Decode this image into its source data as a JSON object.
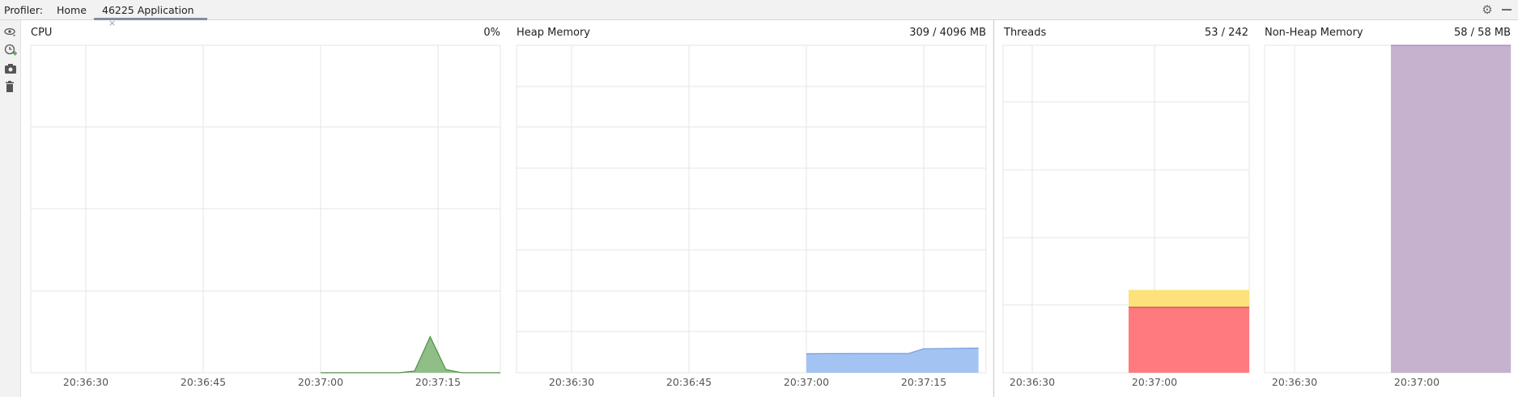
{
  "topbar": {
    "profiler_label": "Profiler:",
    "tabs": [
      {
        "label": "Home"
      },
      {
        "label": "46225 Application",
        "close": "×"
      }
    ],
    "icons": [
      "gear-icon",
      "minimize-icon"
    ]
  },
  "toolbar": {
    "icons": [
      "eye-icon",
      "add-timer-icon",
      "camera-icon",
      "trash-icon"
    ]
  },
  "panels": {
    "cpu": {
      "title": "CPU",
      "value": "0%"
    },
    "heap": {
      "title": "Heap Memory",
      "value": "309 / 4096 MB"
    },
    "threads": {
      "title": "Threads",
      "value": "53 / 242"
    },
    "nonheap": {
      "title": "Non-Heap Memory",
      "value": "58 / 58 MB"
    }
  },
  "colors": {
    "cpu": "#8fbf86",
    "cpu_line": "#4e8f45",
    "heap": "#a3c3f3",
    "heap_line": "#6f9de0",
    "threads_yellow": "#fde27c",
    "threads_red": "#ff7a7f",
    "nonheap": "#c6b1cf",
    "grid": "#e6e6e6"
  },
  "chart_data": [
    {
      "type": "area",
      "title": "CPU",
      "x_ticks": [
        "20:36:30",
        "20:36:45",
        "20:37:00",
        "20:37:15"
      ],
      "series": [
        {
          "values": [
            [
              "20:37:00",
              0
            ],
            [
              "20:37:10",
              0
            ],
            [
              "20:37:12",
              0.5
            ],
            [
              "20:37:14",
              11
            ],
            [
              "20:37:16",
              1
            ],
            [
              "20:37:18",
              0
            ],
            [
              "20:37:23",
              0
            ]
          ]
        }
      ],
      "ylim": [
        0,
        100
      ]
    },
    {
      "type": "area",
      "title": "Heap Memory",
      "x_ticks": [
        "20:36:30",
        "20:36:45",
        "20:37:00",
        "20:37:15"
      ],
      "series": [
        {
          "values": [
            [
              "20:37:00",
              238
            ],
            [
              "20:37:07",
              240
            ],
            [
              "20:37:13",
              240
            ],
            [
              "20:37:15",
              300
            ],
            [
              "20:37:22",
              309
            ]
          ]
        }
      ],
      "ylim": [
        0,
        4096
      ]
    },
    {
      "type": "bar",
      "title": "Threads",
      "x_ticks": [
        "20:36:30",
        "20:37:00"
      ],
      "series": [
        {
          "name": "red",
          "values": [
            [
              "20:37:00",
              200
            ]
          ]
        },
        {
          "name": "yellow",
          "values": [
            [
              "20:37:00",
              53
            ]
          ]
        }
      ],
      "ylim": [
        0,
        1000
      ]
    },
    {
      "type": "area",
      "title": "Non-Heap Memory",
      "x_ticks": [
        "20:36:30",
        "20:37:00"
      ],
      "series": [
        {
          "values": [
            [
              "20:37:00",
              58
            ]
          ]
        }
      ],
      "ylim": [
        0,
        58
      ]
    }
  ]
}
